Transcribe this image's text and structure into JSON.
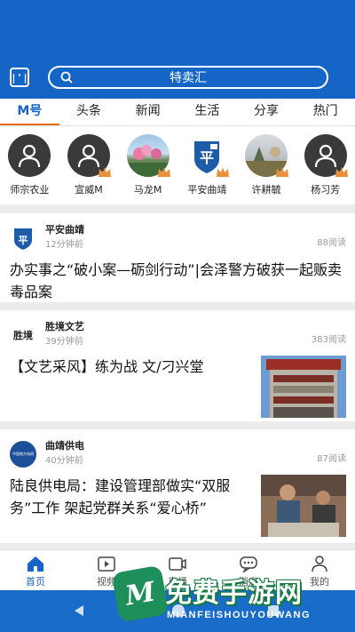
{
  "header": {
    "scan_label": "|'|",
    "search_text": "特卖汇"
  },
  "tabs": [
    "M号",
    "头条",
    "新闻",
    "生活",
    "分享",
    "热门"
  ],
  "accounts": [
    {
      "name": "师宗农业",
      "avatar": "default-user",
      "crown": false
    },
    {
      "name": "宣威M",
      "avatar": "default-user",
      "crown": true
    },
    {
      "name": "马龙M",
      "avatar": "landscape",
      "crown": true
    },
    {
      "name": "平安曲靖",
      "avatar": "police-shield",
      "crown": true
    },
    {
      "name": "许耕毓",
      "avatar": "landscape",
      "crown": true
    },
    {
      "name": "杨习芳",
      "avatar": "default-user",
      "crown": true
    }
  ],
  "feed": [
    {
      "source": "平安曲靖",
      "time": "12分钟前",
      "reads": "88阅读",
      "title": "办实事之“破小案—砺剑行动”|会泽警方破获一起贩卖毒品案"
    },
    {
      "source": "胜境文艺",
      "time": "39分钟前",
      "reads": "383阅读",
      "title": "【文艺采风】练为战 文/刁兴堂",
      "logo_text": "胜境"
    },
    {
      "source": "曲靖供电",
      "time": "40分钟前",
      "reads": "87阅读",
      "title": "陆良供电局：建设管理部做实“双服务”工作 架起党群关系“爱心桥”",
      "logo_text": "中国南方电网"
    }
  ],
  "bottom_nav": [
    {
      "label": "首页",
      "icon": "home-icon",
      "active": true
    },
    {
      "label": "视频",
      "icon": "video-icon",
      "active": false
    },
    {
      "label": "直播",
      "icon": "live-icon",
      "active": false
    },
    {
      "label": "消息",
      "icon": "message-icon",
      "active": false
    },
    {
      "label": "我的",
      "icon": "user-icon",
      "active": false
    }
  ],
  "watermark": {
    "badge": "M",
    "title": "免费手游网",
    "subtitle": "MIANFEISHOUYOUWANG"
  },
  "colors": {
    "brand_blue": "#1565c7",
    "tab_underline": "#e86a1a",
    "crown": "#e8913a"
  }
}
